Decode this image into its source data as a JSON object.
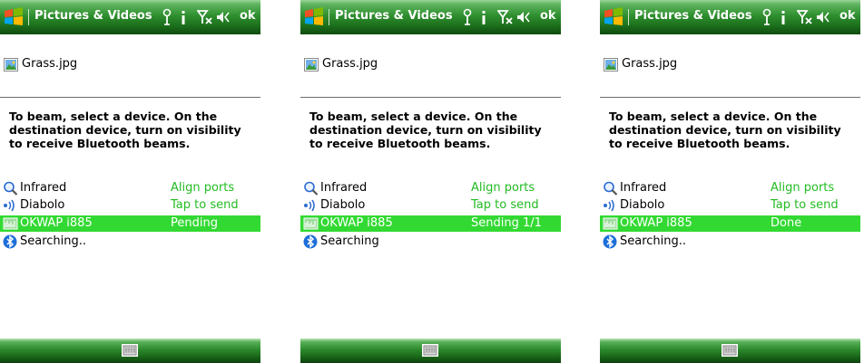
{
  "app": {
    "title": "Pictures & Videos",
    "ok_label": "ok"
  },
  "file": {
    "name": "Grass.jpg",
    "icon": "image-file-icon"
  },
  "instructions": "To beam, select a device. On the destination device, turn on visibility to receive Bluetooth beams.",
  "colors": {
    "titlebar": "#2f8f2f",
    "selection": "#33d933",
    "status_text": "#22bb22"
  },
  "screens": [
    {
      "devices": [
        {
          "name": "Infrared",
          "status": "Align ports",
          "icon": "search-icon"
        },
        {
          "name": "Diabolo",
          "status": "Tap to send",
          "icon": "wireless-device-icon"
        },
        {
          "name": "OKWAP i885",
          "status": "Pending",
          "icon": "phone-device-icon"
        },
        {
          "name": "Searching..",
          "status": "",
          "icon": "bluetooth-icon"
        }
      ]
    },
    {
      "devices": [
        {
          "name": "Infrared",
          "status": "Align ports",
          "icon": "search-icon"
        },
        {
          "name": "Diabolo",
          "status": "Tap to send",
          "icon": "wireless-device-icon"
        },
        {
          "name": "OKWAP i885",
          "status": "Sending 1/1",
          "icon": "phone-device-icon"
        },
        {
          "name": "Searching",
          "status": "",
          "icon": "bluetooth-icon"
        }
      ]
    },
    {
      "devices": [
        {
          "name": "Infrared",
          "status": "Align ports",
          "icon": "search-icon"
        },
        {
          "name": "Diabolo",
          "status": "Tap to send",
          "icon": "wireless-device-icon"
        },
        {
          "name": "OKWAP i885",
          "status": "Done",
          "icon": "phone-device-icon"
        },
        {
          "name": "Searching..",
          "status": "",
          "icon": "bluetooth-icon"
        }
      ]
    }
  ]
}
